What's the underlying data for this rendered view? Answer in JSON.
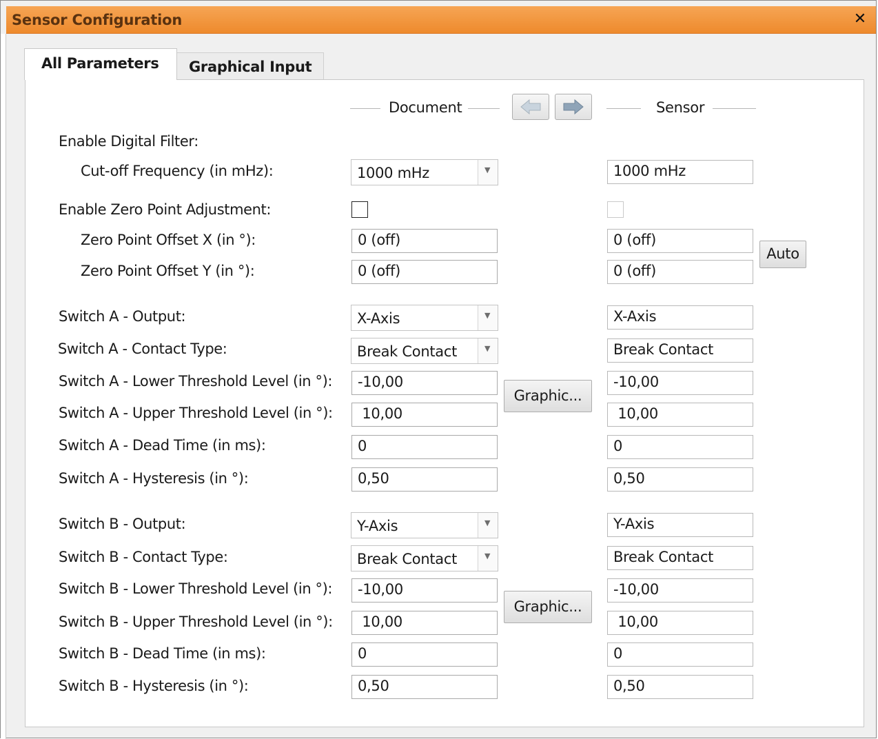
{
  "window": {
    "title": "Sensor Configuration",
    "close_glyph": "✕",
    "accent_color": "#f0922f"
  },
  "tabs": [
    {
      "label": "All Parameters",
      "active": true
    },
    {
      "label": "Graphical Input",
      "active": false
    }
  ],
  "columns": {
    "document": "Document",
    "sensor": "Sensor",
    "copy_to_document_icon": "arrow-left-icon",
    "copy_to_sensor_icon": "arrow-right-icon"
  },
  "rows": {
    "digital_filter": {
      "label": "Enable Digital Filter:"
    },
    "cutoff": {
      "label": "Cut-off Frequency (in mHz):",
      "document": "1000 mHz",
      "sensor": "1000 mHz"
    },
    "zero_point": {
      "label": "Enable Zero Point Adjustment:",
      "document_checked": false,
      "sensor_checked": false
    },
    "offset_x": {
      "label": "Zero Point Offset X (in °):",
      "document": "0 (off)",
      "sensor": "0 (off)"
    },
    "offset_y": {
      "label": "Zero Point Offset Y (in °):",
      "document": "0 (off)",
      "sensor": "0 (off)"
    },
    "a_output": {
      "label": "Switch A - Output:",
      "document": "X-Axis",
      "sensor": "X-Axis"
    },
    "a_contact": {
      "label": "Switch A - Contact Type:",
      "document": "Break Contact",
      "sensor": "Break Contact"
    },
    "a_lower": {
      "label": "Switch A - Lower Threshold Level (in °):",
      "document": "-10,00",
      "sensor": "-10,00"
    },
    "a_upper": {
      "label": "Switch A - Upper Threshold Level (in °):",
      "document": " 10,00",
      "sensor": " 10,00"
    },
    "a_dead": {
      "label": "Switch A - Dead Time (in ms):",
      "document": "0",
      "sensor": "0"
    },
    "a_hyst": {
      "label": "Switch A - Hysteresis (in °):",
      "document": "0,50",
      "sensor": "0,50"
    },
    "b_output": {
      "label": "Switch B - Output:",
      "document": "Y-Axis",
      "sensor": "Y-Axis"
    },
    "b_contact": {
      "label": "Switch B - Contact Type:",
      "document": "Break Contact",
      "sensor": "Break Contact"
    },
    "b_lower": {
      "label": "Switch B - Lower Threshold Level (in °):",
      "document": "-10,00",
      "sensor": "-10,00"
    },
    "b_upper": {
      "label": "Switch B - Upper Threshold Level (in °):",
      "document": " 10,00",
      "sensor": " 10,00"
    },
    "b_dead": {
      "label": "Switch B - Dead Time (in ms):",
      "document": "0",
      "sensor": "0"
    },
    "b_hyst": {
      "label": "Switch B - Hysteresis (in °):",
      "document": "0,50",
      "sensor": "0,50"
    }
  },
  "buttons": {
    "auto": "Auto",
    "graphic_a": "Graphic...",
    "graphic_b": "Graphic..."
  }
}
